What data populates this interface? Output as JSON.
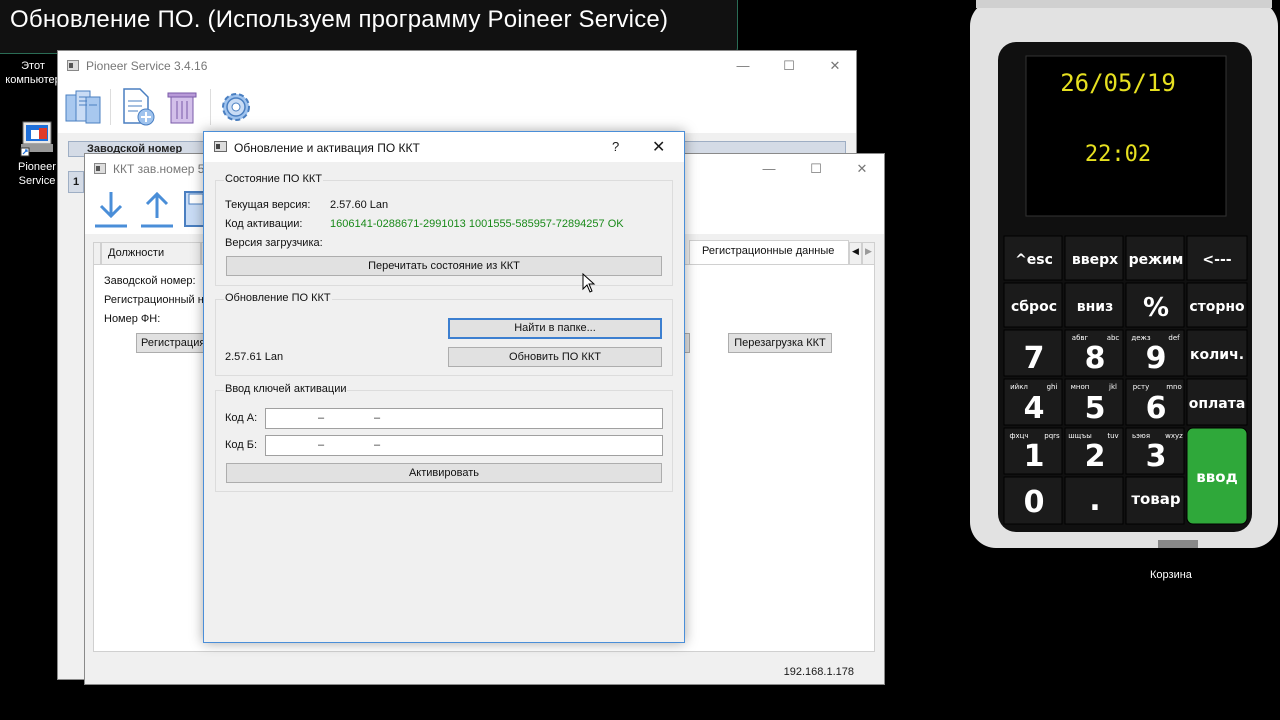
{
  "banner": {
    "title": "Обновление ПО. (Используем программу Poineer Service)"
  },
  "desktop": {
    "this_pc": "Этот компьютер",
    "pioneer": "Pioneer Service",
    "recycle": "Корзина"
  },
  "main_window": {
    "title": "Pioneer Service 3.4.16",
    "header_band": "Заводской номер"
  },
  "kkt_window": {
    "title": "ККТ зав.номер 5",
    "tabs": [
      "Должности",
      "Регистрационные данные"
    ],
    "fields": {
      "serial": "Заводской номер:",
      "reg": "Регистрационный н",
      "fn": "Номер ФН:"
    },
    "reg_button": "Регистрация",
    "reboot_button": "Перезагрузка ККТ",
    "row_number": "1",
    "status_ip": "192.168.1.178"
  },
  "dialog": {
    "title": "Обновление и активация ПО ККТ",
    "help": "?",
    "state_group": {
      "title": "Состояние ПО ККТ",
      "current_version_label": "Текущая версия:",
      "current_version_value": "2.57.60 Lan",
      "activation_code_label": "Код активации:",
      "activation_code_value": "1606141-0288671-2991013 1001555-585957-72894257 OK",
      "loader_version_label": "Версия загрузчика:",
      "reread_button": "Перечитать состояние из ККТ"
    },
    "update_group": {
      "title": "Обновление ПО ККТ",
      "find_button": "Найти в папке...",
      "found_version": "2.57.61 Lan",
      "update_button": "Обновить ПО ККТ"
    },
    "keys_group": {
      "title": "Ввод ключей активации",
      "code_a_label": "Код А:",
      "code_b_label": "Код Б:",
      "activate_button": "Активировать"
    }
  },
  "device": {
    "date": "26/05/19",
    "time": "22:02",
    "keys": [
      [
        "^esc",
        "вверх",
        "режим",
        "<---"
      ],
      [
        "сброс",
        "вниз",
        "%",
        "сторно"
      ],
      [
        "7",
        "8",
        "9",
        "колич."
      ],
      [
        "4",
        "5",
        "6",
        "оплата"
      ],
      [
        "1",
        "2",
        "3",
        "ввод"
      ],
      [
        "0",
        ".",
        "товар"
      ]
    ],
    "sub_labels": {
      "k8": "абвг",
      "k8r": "abc",
      "k9": "дежз",
      "k9r": "def",
      "k4": "ийкл",
      "k4r": "ghi",
      "k5": "мноп",
      "k5r": "jkl",
      "k6": "рсту",
      "k6r": "mno",
      "k1": "фхцч",
      "k1r": "pqrs",
      "k2": "шщъы",
      "k2r": "tuv",
      "k3": "ьэюя",
      "k3r": "wxyz"
    },
    "colors": {
      "enter": "#2fa83a",
      "screen_text": "#e6e020",
      "key_bg": "#1b1b1b"
    }
  }
}
